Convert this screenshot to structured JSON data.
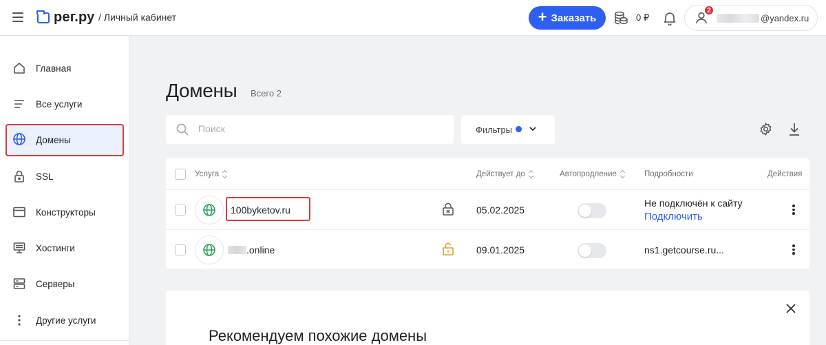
{
  "header": {
    "logo_text": "рег.ру",
    "breadcrumb": "/ Личный кабинет",
    "order_label": "Заказать",
    "balance": "0 ₽",
    "notification_count": "2",
    "account_email": "@yandex.ru"
  },
  "sidebar": {
    "items": [
      {
        "label": "Главная",
        "icon": "home-icon"
      },
      {
        "label": "Все услуги",
        "icon": "list-icon"
      },
      {
        "label": "Домены",
        "icon": "globe-icon",
        "active": true
      },
      {
        "label": "SSL",
        "icon": "lock-icon"
      },
      {
        "label": "Конструкторы",
        "icon": "browser-window-icon"
      },
      {
        "label": "Хостинги",
        "icon": "monitor-icon"
      },
      {
        "label": "Серверы",
        "icon": "server-icon"
      },
      {
        "label": "Другие услуги",
        "icon": "more-vertical-icon"
      }
    ]
  },
  "page": {
    "title": "Домены",
    "count": "Всего 2"
  },
  "toolbar": {
    "search_placeholder": "Поиск",
    "filters_label": "Фильтры"
  },
  "table": {
    "columns": {
      "service": "Услуга",
      "valid_until": "Действует до",
      "autorenew": "Автопродление",
      "details": "Подробности",
      "actions": "Действия"
    },
    "rows": [
      {
        "name": "100byketov.ru",
        "valid_until": "05.02.2025",
        "autorenew": false,
        "lock_state": "locked",
        "details": "Не подключён к сайту",
        "action_link": "Подключить"
      },
      {
        "name": ".online",
        "valid_until": "09.01.2025",
        "autorenew": false,
        "lock_state": "unlocked",
        "details": "ns1.getcourse.ru..."
      }
    ]
  },
  "recommendation": {
    "title": "Рекомендуем похожие домены"
  },
  "colors": {
    "accent": "#2f5ef2",
    "highlight_border": "#d63c3c",
    "globe_green": "#2fa35a",
    "unlock_orange": "#e0a020",
    "badge_red": "#e02b3c"
  }
}
